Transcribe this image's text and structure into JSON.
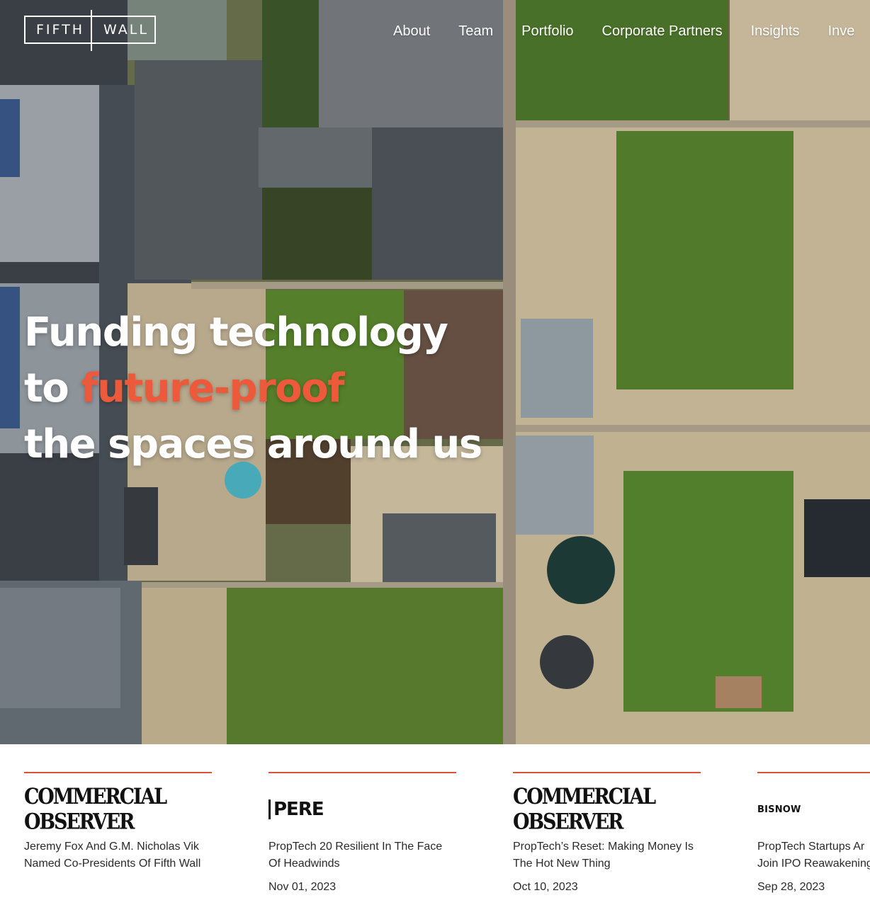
{
  "brand": {
    "logo_left": "FIFTH",
    "logo_right": "WALL",
    "text_color": "#ffffff",
    "accent_color": "#ec5a3b"
  },
  "nav": {
    "items": [
      {
        "label": "About"
      },
      {
        "label": "Team"
      },
      {
        "label": "Portfolio"
      },
      {
        "label": "Corporate Partners"
      },
      {
        "label": "Insights"
      },
      {
        "label": "Inve"
      }
    ]
  },
  "hero": {
    "line1": "Funding technology",
    "line2_prefix": "to",
    "line2_accent": "future-proof",
    "line3": "the spaces around us"
  },
  "press": {
    "rule_color": "#d9533a",
    "items": [
      {
        "publication": "COMMERCIAL OBSERVER",
        "title": "Jeremy Fox And G.M. Nicholas Vik Named Co-Presidents Of Fifth Wall",
        "date": ""
      },
      {
        "publication": "PERE",
        "title": "PropTech 20 Resilient In The Face Of Headwinds",
        "date": "Nov 01, 2023"
      },
      {
        "publication": "COMMERCIAL OBSERVER",
        "title": "PropTech’s Reset: Making Money Is The Hot New Thing",
        "date": "Oct 10, 2023"
      },
      {
        "publication": "BISNOW",
        "title": "PropTech Startups Ar Join IPO Reawakening",
        "date": "Sep 28, 2023"
      }
    ]
  }
}
